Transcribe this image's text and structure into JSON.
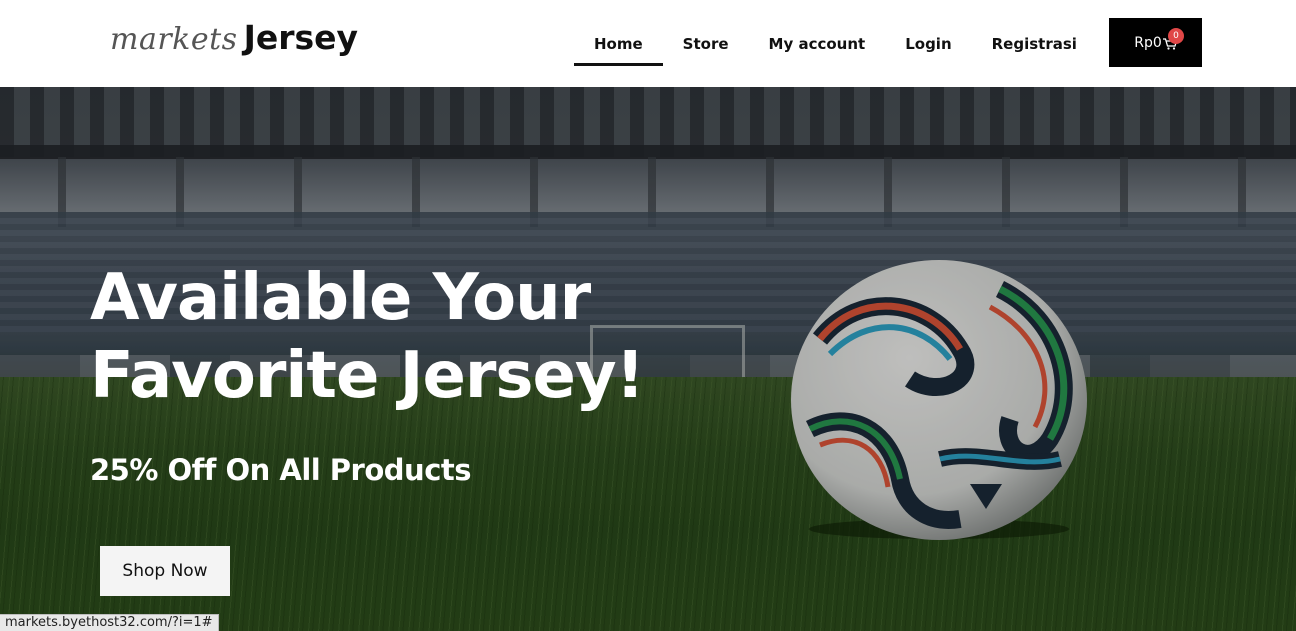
{
  "header": {
    "logo_script": "markets",
    "logo_bold": "Jersey",
    "nav": [
      {
        "label": "Home",
        "active": true
      },
      {
        "label": "Store",
        "active": false
      },
      {
        "label": "My account",
        "active": false
      },
      {
        "label": "Login",
        "active": false
      },
      {
        "label": "Registrasi",
        "active": false
      }
    ],
    "cart": {
      "total": "Rp0",
      "count": "0",
      "icon": "cart-icon",
      "badge_color": "#e04747"
    }
  },
  "hero": {
    "title_line1": "Available Your",
    "title_line2": "Favorite Jersey!",
    "subtitle": "25% Off On All Products",
    "button_label": "Shop Now",
    "image": "soccer-ball-stadium-icon"
  },
  "status_bar": {
    "url": "markets.byethost32.com/?i=1#"
  }
}
